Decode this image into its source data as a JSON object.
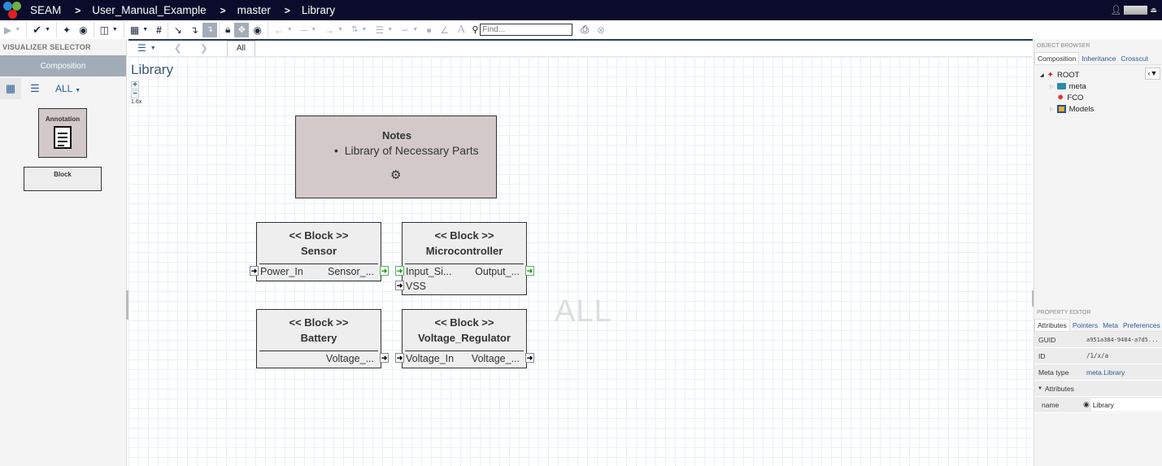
{
  "topbar": {
    "app_name": "SEAM",
    "breadcrumbs": [
      "User_Manual_Example",
      "master",
      "Library"
    ],
    "separator": ">",
    "user_icon": "user-icon",
    "eject_icon": "eject-icon"
  },
  "toolbar": {
    "find_placeholder": "Find...",
    "buttons": [
      "play",
      "check-circle",
      "crosshair",
      "map-marker",
      "columns",
      "grid",
      "hash",
      "arrow-diagonal",
      "connection",
      "tree-active",
      "lock",
      "move-active",
      "eye",
      "arrow-left",
      "line",
      "arrow-right",
      "sliders",
      "line-weight",
      "curve",
      "color-drop",
      "pencil",
      "font",
      "search",
      "print",
      "close-circle"
    ]
  },
  "left_panel": {
    "title": "VISUALIZER SELECTOR",
    "active_visualizer": "Composition",
    "filter_label": "ALL",
    "items": [
      {
        "label": "Annotation",
        "icon": "document-icon"
      },
      {
        "label": "Block"
      }
    ]
  },
  "center": {
    "tab_label": "All",
    "canvas_title": "Library",
    "zoom_in": "+",
    "zoom_out": "−",
    "zoom_level": "1.6x",
    "watermark": "ALL",
    "notes": {
      "title": "Notes",
      "items": [
        "Library of Necessary Parts"
      ]
    },
    "blocks": [
      {
        "stereotype": "<< Block >>",
        "name": "Sensor",
        "ports": [
          {
            "left": "Power_In",
            "right": "Sensor_..."
          }
        ]
      },
      {
        "stereotype": "<< Block >>",
        "name": "Microcontroller",
        "ports": [
          {
            "left": "Input_Si...",
            "right": "Output_..."
          },
          {
            "left": "VSS",
            "right": ""
          }
        ]
      },
      {
        "stereotype": "<< Block >>",
        "name": "Battery",
        "ports": [
          {
            "left": "",
            "right": "Voltage_..."
          }
        ]
      },
      {
        "stereotype": "<< Block >>",
        "name": "Voltage_Regulator",
        "ports": [
          {
            "left": "Voltage_In",
            "right": "Voltage_..."
          }
        ]
      }
    ]
  },
  "object_browser": {
    "title": "OBJECT BROWSER",
    "tabs": [
      "Composition",
      "Inheritance",
      "Crosscut"
    ],
    "tree": [
      {
        "label": "ROOT",
        "expanded": true,
        "level": 0
      },
      {
        "label": "meta",
        "expanded": false,
        "level": 1
      },
      {
        "label": "FCO",
        "level": 1
      },
      {
        "label": "Models",
        "expanded": false,
        "level": 1
      }
    ]
  },
  "property_editor": {
    "title": "PROPERTY EDITOR",
    "tabs": [
      "Attributes",
      "Pointers",
      "Meta",
      "Preferences"
    ],
    "rows": [
      {
        "key": "GUID",
        "value": "a951a384-9484-a7d5..."
      },
      {
        "key": "ID",
        "value": "/1/x/a"
      },
      {
        "key": "Meta type",
        "value": "meta.Library"
      }
    ],
    "section": "Attributes",
    "attributes": [
      {
        "key": "name",
        "value": "Library"
      }
    ]
  },
  "colors": {
    "topbar": "#0b0b2b",
    "accent": "#2e5b9c",
    "annotation_fill": "#d3c9c9",
    "block_fill": "#eeeeee"
  }
}
